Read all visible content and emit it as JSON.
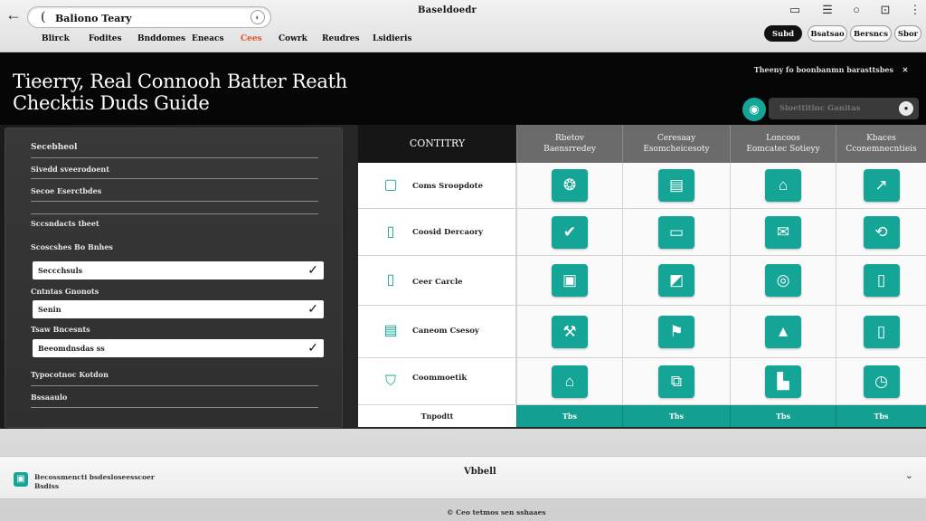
{
  "header": {
    "back_icon": "arrow-left-icon",
    "search_value": "Baliono Teary",
    "app_title": "Baseldoedr",
    "nav": [
      "Blirck",
      "Fodites",
      "Bnddomes",
      "Eneacs",
      "Cees",
      "Cowrk",
      "Reudres",
      "Lsidieris"
    ],
    "nav_active_index": 4,
    "right_icons": [
      "window-icon",
      "menu-icon",
      "search-icon",
      "tab-icon",
      "more-icon"
    ],
    "pills": [
      "Subd",
      "Bsatsao",
      "Bersncs",
      "Sbor"
    ]
  },
  "hero": {
    "title_line1": "Tieerry, Real Connooh Batter Reath",
    "title_line2": "Checktis Duds Guide",
    "side_text": "Theeny fo boonbanmn barasttsbes",
    "find_placeholder": "Sioettitinc Ganitas"
  },
  "form": {
    "heading": "Secebheol",
    "fields": [
      {
        "label": "Sivedd sveerodoent",
        "type": "line"
      },
      {
        "label": "Secoe Eserctbdes",
        "type": "line"
      },
      {
        "label": "Sccsndacts tbeet",
        "type": "line"
      },
      {
        "label": "Scoscshes Bo Bnhes",
        "type": "select",
        "value": "Seccchsuls"
      },
      {
        "label": "Cntntas Gnonots",
        "type": "select",
        "value": "Senin"
      },
      {
        "label": "Tsaw Bncesnts",
        "type": "select",
        "value": "Beeomdnsdas ss"
      },
      {
        "label": "Typocotnoc Kotdon",
        "type": "line"
      },
      {
        "label": "Bssaaulo",
        "type": "line"
      }
    ]
  },
  "table": {
    "first_header": "CONTITRY",
    "columns": [
      {
        "line1": "Rbetov",
        "line2": "Baensrredey"
      },
      {
        "label_line1": "Ceresaay",
        "label_line2": "Esomcheicesoty"
      },
      {
        "label_line1": "Loncoos",
        "label_line2": "Eomcatec Sotieyy"
      },
      {
        "label_line1": "Kbaces",
        "label_line2": "Cconemnecntieis"
      }
    ],
    "rows": [
      {
        "icon": "phone-icon",
        "label": "Coms Sroopdote",
        "cells": [
          "compass-icon",
          "monitor-icon",
          "pin-icon",
          "chart-icon"
        ]
      },
      {
        "icon": "tablet-icon",
        "label": "Coosid Dercaory",
        "cells": [
          "check-icon",
          "laptop-icon",
          "mail-icon",
          "sync-icon"
        ]
      },
      {
        "icon": "device-icon",
        "label": "Ceer Carcle",
        "cells": [
          "lock-icon",
          "screen-icon",
          "shield-icon",
          "phone-icon"
        ]
      },
      {
        "icon": "clipboard-icon",
        "label": "Caneom Csesoy",
        "cells": [
          "tools-icon",
          "flag-icon",
          "user-icon",
          "tablet-icon"
        ]
      },
      {
        "icon": "badge-icon",
        "label": "Coommoetik",
        "cells": [
          "bag-icon",
          "doc-icon",
          "box-icon",
          "timer-icon"
        ]
      }
    ],
    "footer_first": "Tnpodtt",
    "footer": [
      "Tbs",
      "Tbs",
      "Tbs",
      "Tbs"
    ]
  },
  "bottom": {
    "card_line1": "Becossmencti bsdesloseesscoer",
    "card_line2": "Bsdiss",
    "card_center": "Vbbell",
    "footer_text": "Ceo tetmos sen sshaaes"
  },
  "colors": {
    "accent": "#14a596",
    "nav_active": "#e0522b",
    "hero_bg": "#060606"
  }
}
